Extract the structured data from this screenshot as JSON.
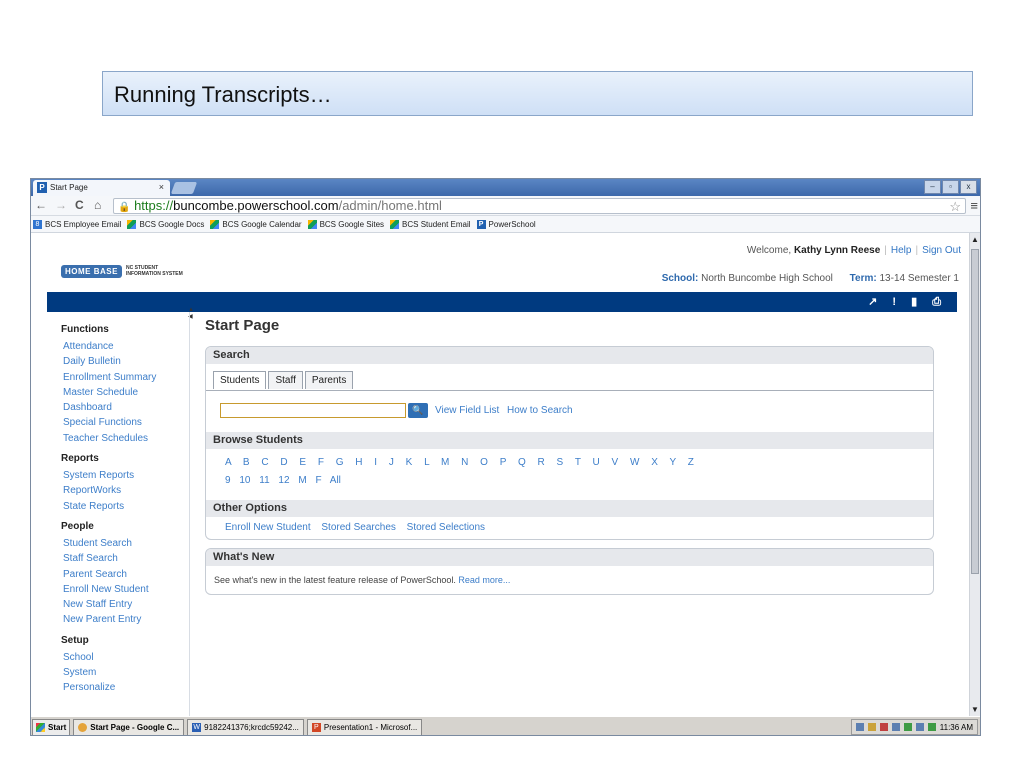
{
  "slide": {
    "title": "Running Transcripts…"
  },
  "browser": {
    "tab_title": "Start Page",
    "tab_close": "×",
    "favicon": "P",
    "window_controls": [
      "–",
      "▫",
      "x"
    ],
    "nav": {
      "back": "←",
      "forward": "→",
      "reload": "C",
      "home": "⌂"
    },
    "url": {
      "scheme": "https://",
      "host": "buncombe.powerschool.com",
      "path": "/admin/home.html"
    },
    "star": "☆",
    "menu": "≡",
    "bookmarks": [
      {
        "label": "BCS Employee Email",
        "icon": "google-icon"
      },
      {
        "label": "BCS Google Docs",
        "icon": "google-apps-icon"
      },
      {
        "label": "BCS Google Calendar",
        "icon": "google-apps-icon"
      },
      {
        "label": "BCS Google Sites",
        "icon": "google-apps-icon"
      },
      {
        "label": "BCS Student Email",
        "icon": "google-apps-icon"
      },
      {
        "label": "PowerSchool",
        "icon": "powerschool-icon"
      }
    ]
  },
  "header": {
    "welcome_prefix": "Welcome, ",
    "user_name": "Kathy Lynn Reese",
    "help": "Help",
    "sign_out": "Sign Out",
    "logo_badge": "HOME BASE",
    "logo_sub1": "NC STUDENT",
    "logo_sub2": "INFORMATION SYSTEM",
    "school_label": "School:",
    "school_value": "North Buncombe High School",
    "term_label": "Term:",
    "term_value": "13-14 Semester 1",
    "tools": "↗ ! ▮ ⎙"
  },
  "sidebar": {
    "groups": [
      {
        "title": "Functions",
        "items": [
          "Attendance",
          "Daily Bulletin",
          "Enrollment Summary",
          "Master Schedule",
          "Dashboard",
          "Special Functions",
          "Teacher Schedules"
        ]
      },
      {
        "title": "Reports",
        "items": [
          "System Reports",
          "ReportWorks",
          "State Reports"
        ]
      },
      {
        "title": "People",
        "items": [
          "Student Search",
          "Staff Search",
          "Parent Search",
          "Enroll New Student",
          "New Staff Entry",
          "New Parent Entry"
        ]
      },
      {
        "title": "Setup",
        "items": [
          "School",
          "System",
          "Personalize"
        ]
      }
    ]
  },
  "main": {
    "page_title": "Start Page",
    "search": {
      "heading": "Search",
      "tabs": [
        "Students",
        "Staff",
        "Parents"
      ],
      "input_value": "",
      "view_field_list": "View Field List",
      "how_to_search": "How to Search"
    },
    "browse": {
      "heading": "Browse Students",
      "letters": [
        "A",
        "B",
        "C",
        "D",
        "E",
        "F",
        "G",
        "H",
        "I",
        "J",
        "K",
        "L",
        "M",
        "N",
        "O",
        "P",
        "Q",
        "R",
        "S",
        "T",
        "U",
        "V",
        "W",
        "X",
        "Y",
        "Z"
      ],
      "grades": [
        "9",
        "10",
        "11",
        "12",
        "M",
        "F",
        "All"
      ]
    },
    "other": {
      "heading": "Other Options",
      "links": [
        "Enroll New Student",
        "Stored Searches",
        "Stored Selections"
      ]
    },
    "whats_new": {
      "heading": "What's New",
      "text": "See what's new in the latest feature release of PowerSchool.",
      "link": "Read more..."
    }
  },
  "taskbar": {
    "start": "Start",
    "items": [
      {
        "label": "Start Page - Google C...",
        "icon": "chrome-icon"
      },
      {
        "label": "9182241376;krcdc59242...",
        "icon": "word-icon"
      },
      {
        "label": "Presentation1 - Microsof...",
        "icon": "powerpoint-icon"
      }
    ],
    "clock": "11:36 AM"
  }
}
